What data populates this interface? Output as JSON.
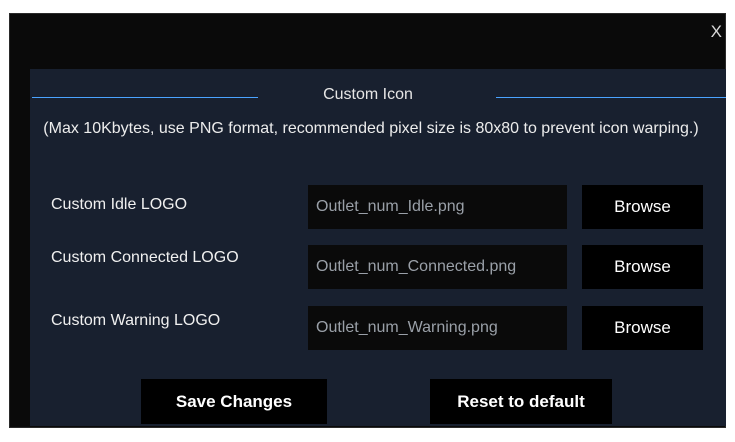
{
  "dialog": {
    "close_label": "X"
  },
  "section": {
    "title": "Custom Icon",
    "note": "(Max 10Kbytes, use PNG format, recommended pixel size is 80x80 to prevent icon warping.)"
  },
  "rows": [
    {
      "label": "Custom Idle LOGO",
      "value": "Outlet_num_Idle.png",
      "button": "Browse"
    },
    {
      "label": "Custom Connected LOGO",
      "value": "Outlet_num_Connected.png",
      "button": "Browse"
    },
    {
      "label": "Custom Warning LOGO",
      "value": "Outlet_num_Warning.png",
      "button": "Browse"
    }
  ],
  "actions": {
    "save_label": "Save Changes",
    "reset_label": "Reset to default"
  },
  "colors": {
    "dialog_background": "#0a0a0a",
    "panel_background": "#18202f",
    "accent_line": "#4aa3ff",
    "button_background": "#000000"
  }
}
